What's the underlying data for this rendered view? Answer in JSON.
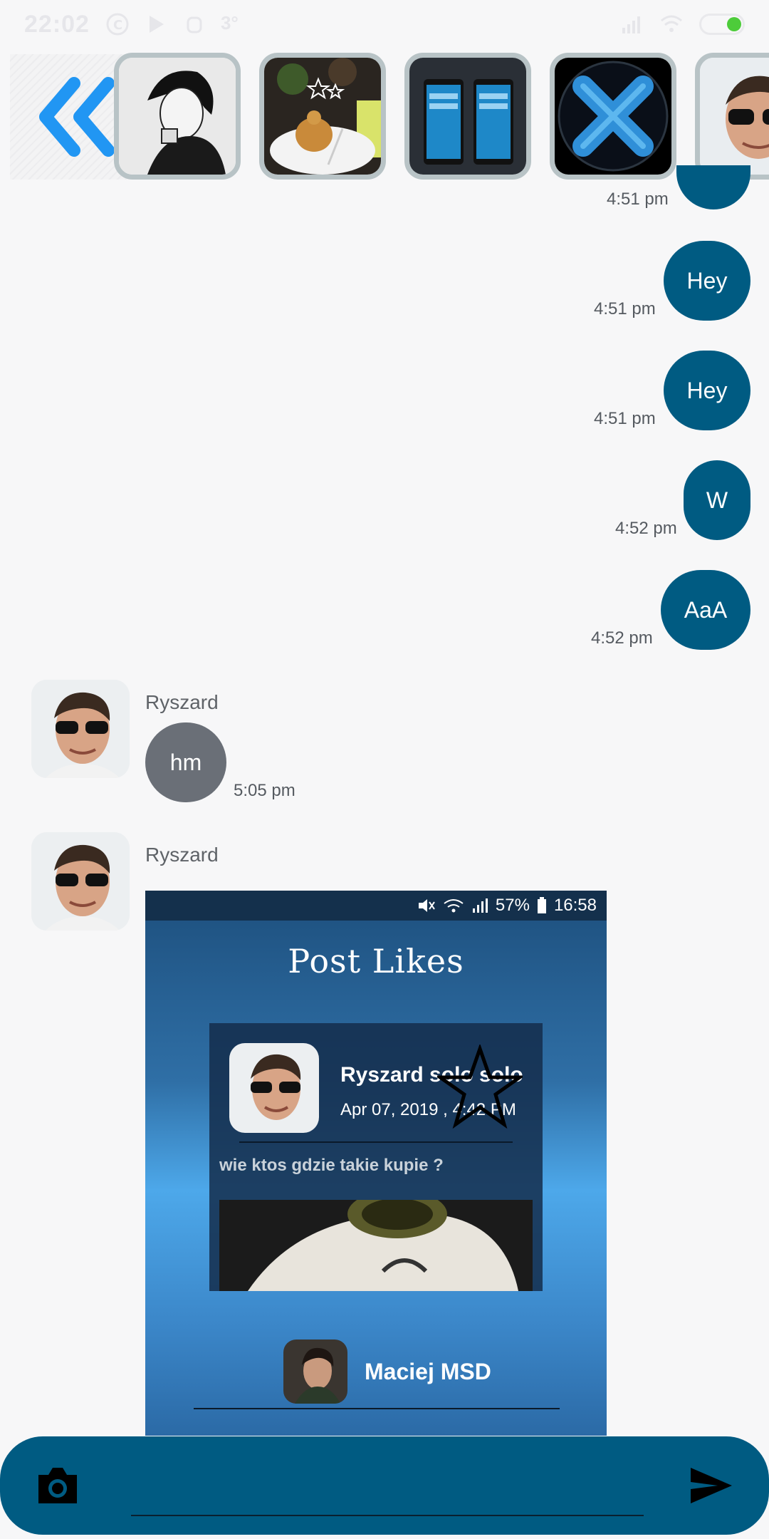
{
  "status_bar": {
    "time": "22:02",
    "icons": [
      "notification-icon",
      "play-store-icon",
      "hand-icon",
      "temperature-icon"
    ],
    "temperature": "3°",
    "right_icons": [
      "signal-icon",
      "wifi-icon",
      "battery-icon"
    ]
  },
  "strip": {
    "back_icon": "double-chevron-left-icon",
    "thumbnails": [
      {
        "name": "manga-boy-thumbnail"
      },
      {
        "name": "dessert-thumbnail"
      },
      {
        "name": "phones-thumbnail"
      },
      {
        "name": "blue-x-thumbnail"
      },
      {
        "name": "ryszard-thumbnail"
      }
    ]
  },
  "outgoing": [
    {
      "text": "",
      "time": "4:51 pm"
    },
    {
      "text": "Hey",
      "time": "4:51 pm"
    },
    {
      "text": "Hey",
      "time": "4:51 pm"
    },
    {
      "text": "W",
      "time": "4:52 pm"
    },
    {
      "text": "AaA",
      "time": "4:52 pm"
    }
  ],
  "incoming": [
    {
      "sender": "Ryszard",
      "text": "hm",
      "time": "5:05 pm"
    },
    {
      "sender": "Ryszard"
    }
  ],
  "shared_image": {
    "status_text": "57%",
    "status_time": "16:58",
    "title": "Post Likes",
    "post": {
      "author": "Ryszard solo solo",
      "date": "Apr 07, 2019 , 4:42 PM",
      "text": "wie ktos gdzie takie kupie ?"
    },
    "liker": "Maciej  MSD"
  },
  "input": {
    "placeholder": "",
    "camera_icon": "camera-icon",
    "send_icon": "send-icon"
  },
  "colors": {
    "accent": "#005b82",
    "incoming_bubble": "#6a6f77",
    "back_arrow": "#2196f3"
  }
}
